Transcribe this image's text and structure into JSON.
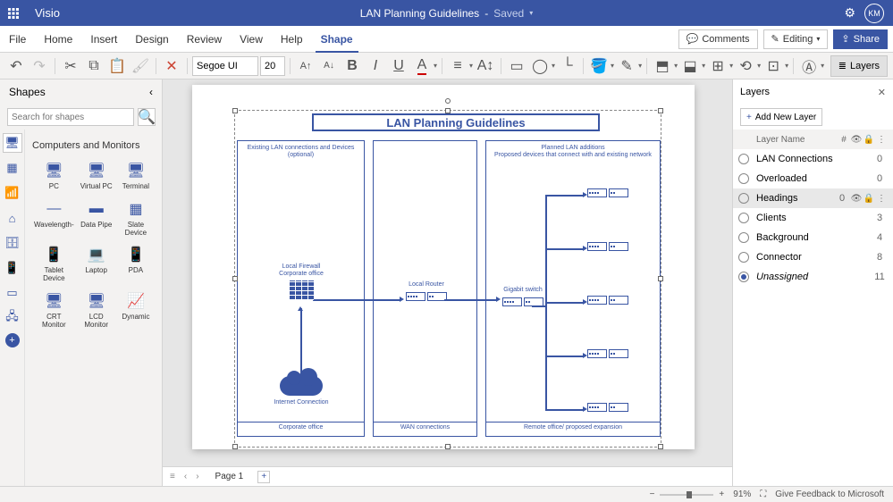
{
  "app": {
    "name": "Visio",
    "doc_title": "LAN Planning Guidelines",
    "save_state": "Saved",
    "user_initials": "KM"
  },
  "menu": {
    "tabs": [
      "File",
      "Home",
      "Insert",
      "Design",
      "Review",
      "View",
      "Help",
      "Shape"
    ],
    "active": 7,
    "comments": "Comments",
    "editing": "Editing",
    "share": "Share"
  },
  "toolbar": {
    "font": "Segoe UI",
    "size": "20",
    "layers": "Layers"
  },
  "shapes": {
    "panel_title": "Shapes",
    "search_placeholder": "Search for shapes",
    "gallery_title": "Computers and Monitors",
    "items": [
      "PC",
      "Virtual PC",
      "Terminal",
      "Wavelength-",
      "Data Pipe",
      "Slate Device",
      "Tablet Device",
      "Laptop",
      "PDA",
      "CRT Monitor",
      "LCD Monitor",
      "Dynamic"
    ]
  },
  "diagram": {
    "title": "LAN Planning Guidelines",
    "region1_head": "Existing LAN connections and Devices (optional)",
    "region2_head": "",
    "region3_head": "Planned LAN additions\nProposed devices that connect with and existing network",
    "region1_foot": "Corporate office",
    "region2_foot": "WAN connections",
    "region3_foot": "Remote office/ proposed expansion",
    "firewall_label": "Local Firewall\nCorporate office",
    "cloud_label": "Internet Connection",
    "router_label": "Local Router",
    "switch_label": "Gigabit switch"
  },
  "layers": {
    "title": "Layers",
    "add": "Add New Layer",
    "col_name": "Layer Name",
    "rows": [
      {
        "name": "LAN Connections",
        "count": "0",
        "sel": false
      },
      {
        "name": "Overloaded",
        "count": "0",
        "sel": false
      },
      {
        "name": "Headings",
        "count": "0",
        "sel": true,
        "icons": true
      },
      {
        "name": "Clients",
        "count": "3",
        "sel": false
      },
      {
        "name": "Background",
        "count": "4",
        "sel": false
      },
      {
        "name": "Connector",
        "count": "8",
        "sel": false
      },
      {
        "name": "Unassigned",
        "count": "11",
        "sel": false,
        "on": true,
        "italic": true
      }
    ]
  },
  "pagebar": {
    "page": "Page 1"
  },
  "status": {
    "zoom": "91%",
    "feedback": "Give Feedback to Microsoft"
  }
}
